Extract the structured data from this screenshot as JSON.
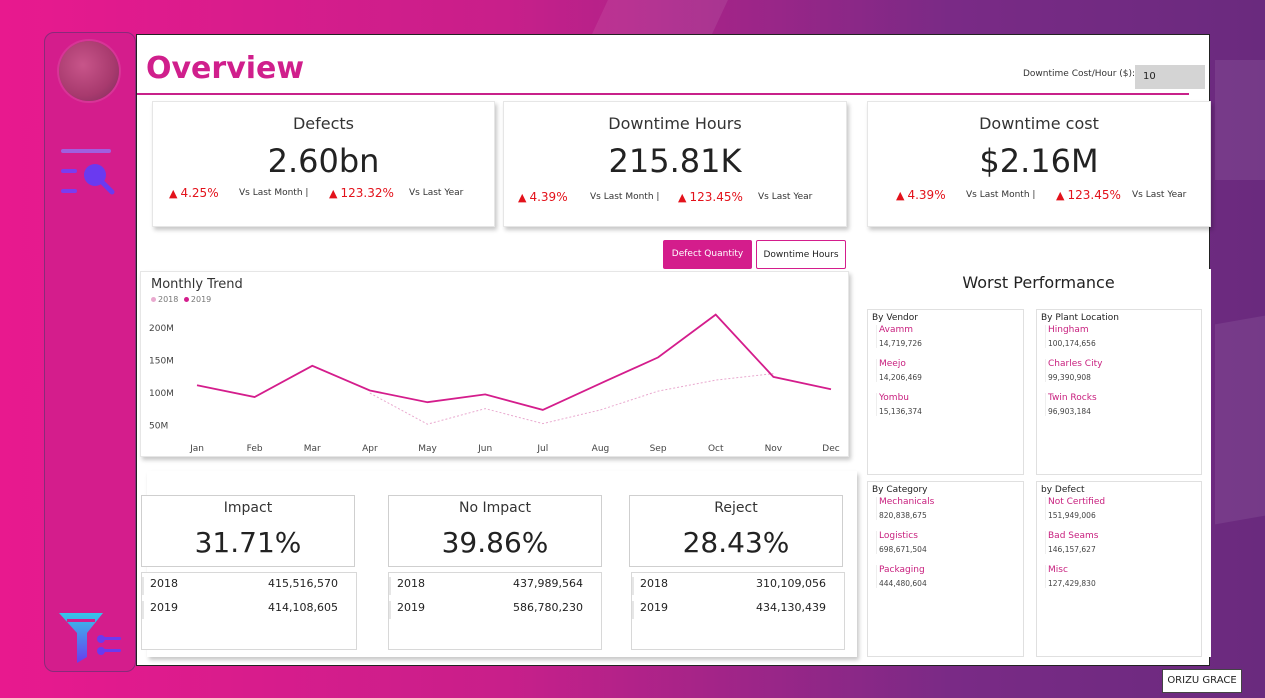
{
  "header": {
    "title": "Overview",
    "downtime_cost_label": "Downtime Cost/Hour ($):",
    "downtime_cost_value": "10"
  },
  "sidebar": {
    "icons": [
      "logo-icon",
      "search-report-icon",
      "filter-icon"
    ]
  },
  "kpis": [
    {
      "title": "Defects",
      "value": "2.60bn",
      "month_delta": "4.25%",
      "month_label": "Vs Last Month |",
      "year_delta": "123.32%",
      "year_label": "Vs Last Year"
    },
    {
      "title": "Downtime Hours",
      "value": "215.81K",
      "month_delta": "4.39%",
      "month_label": "Vs Last Month |",
      "year_delta": "123.45%",
      "year_label": "Vs Last Year"
    },
    {
      "title": "Downtime cost",
      "value": "$2.16M",
      "month_delta": "4.39%",
      "month_label": "Vs Last Month |",
      "year_delta": "123.45%",
      "year_label": "Vs Last Year"
    }
  ],
  "toggles": {
    "active": "Defect Quantity",
    "inactive": "Downtime Hours"
  },
  "trend": {
    "title": "Monthly Trend",
    "legend_2018": "2018",
    "legend_2019": "2019"
  },
  "chart_data": {
    "type": "line",
    "title": "Monthly Trend",
    "categories": [
      "Jan",
      "Feb",
      "Mar",
      "Apr",
      "May",
      "Jun",
      "Jul",
      "Aug",
      "Sep",
      "Oct",
      "Nov",
      "Dec"
    ],
    "y_ticks": [
      "50M",
      "100M",
      "150M",
      "200M"
    ],
    "ylim": [
      40,
      225
    ],
    "series": [
      {
        "name": "2018",
        "color": "#e9a9cf",
        "dashed": true,
        "values": [
          null,
          null,
          null,
          100,
          52,
          76,
          53,
          74,
          103,
          120,
          130,
          null
        ]
      },
      {
        "name": "2019",
        "color": "#d41d8c",
        "dashed": false,
        "values": [
          112,
          94,
          142,
          104,
          86,
          98,
          74,
          115,
          155,
          221,
          125,
          106
        ]
      }
    ],
    "grid": false,
    "legend": "top-left"
  },
  "worst": {
    "title": "Worst Performance",
    "panels": [
      {
        "head": "By Vendor",
        "items": [
          {
            "name": "Avamm",
            "value": "14,719,726"
          },
          {
            "name": "Meejo",
            "value": "14,206,469"
          },
          {
            "name": "Yombu",
            "value": "15,136,374"
          }
        ]
      },
      {
        "head": "By Plant Location",
        "items": [
          {
            "name": "Hingham",
            "value": "100,174,656"
          },
          {
            "name": "Charles City",
            "value": "99,390,908"
          },
          {
            "name": "Twin Rocks",
            "value": "96,903,184"
          }
        ]
      },
      {
        "head": "By Category",
        "items": [
          {
            "name": "Mechanicals",
            "value": "820,838,675"
          },
          {
            "name": "Logistics",
            "value": "698,671,504"
          },
          {
            "name": "Packaging",
            "value": "444,480,604"
          }
        ]
      },
      {
        "head": "by Defect",
        "items": [
          {
            "name": "Not Certified",
            "value": "151,949,006"
          },
          {
            "name": "Bad Seams",
            "value": "146,157,627"
          },
          {
            "name": "Misc",
            "value": "127,429,830"
          }
        ]
      }
    ]
  },
  "impact": [
    {
      "title": "Impact",
      "value": "31.71%",
      "rows": [
        {
          "year": "2018",
          "num": "415,516,570"
        },
        {
          "year": "2019",
          "num": "414,108,605"
        }
      ]
    },
    {
      "title": "No Impact",
      "value": "39.86%",
      "rows": [
        {
          "year": "2018",
          "num": "437,989,564"
        },
        {
          "year": "2019",
          "num": "586,780,230"
        }
      ]
    },
    {
      "title": "Reject",
      "value": "28.43%",
      "rows": [
        {
          "year": "2018",
          "num": "310,109,056"
        },
        {
          "year": "2019",
          "num": "434,130,439"
        }
      ]
    }
  ],
  "footer": {
    "owner": "ORIZU GRACE"
  }
}
